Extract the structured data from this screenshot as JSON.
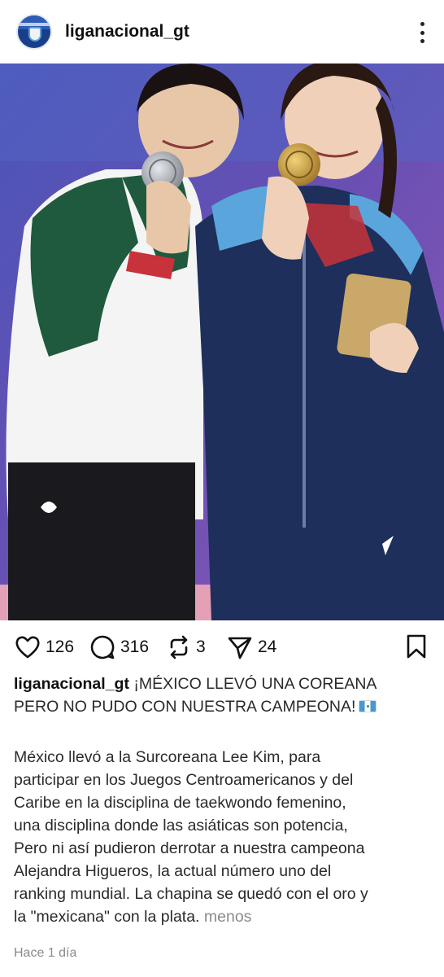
{
  "header": {
    "username": "liganacional_gt",
    "avatar_icon": "club-crest-icon",
    "more_icon": "more-vertical-icon"
  },
  "photo": {
    "description_icon": "post-photo",
    "colors": {
      "background": "#5b4fb0",
      "mexico_green": "#1f5a3e",
      "guatemala_navy": "#1d2f5a",
      "guatemala_light_blue": "#5aa6dc",
      "gold": "#c9a24a",
      "silver": "#b9bcc2"
    }
  },
  "actions": {
    "likes": "126",
    "comments": "316",
    "reposts": "3",
    "shares": "24",
    "icons": [
      "heart-icon",
      "comment-icon",
      "repost-icon",
      "share-icon",
      "bookmark-icon"
    ]
  },
  "caption": {
    "username": "liganacional_gt",
    "headline_line1": " ¡MÉXICO LLEVÓ UNA COREANA",
    "headline_line2": "PERO NO PUDO CON NUESTRA CAMPEONA!",
    "body_lines": [
      "México llevó a la Surcoreana Lee Kim, para",
      "participar en los Juegos Centroamericanos y del",
      "Caribe en la disciplina de taekwondo femenino,",
      "una disciplina donde las asiáticas son potencia,",
      "Pero ni así pudieron derrotar a nuestra campeona",
      "Alejandra Higueros, la actual número uno del",
      "ranking mundial. La chapina se quedó con el oro y",
      "la \"mexicana\" con la plata."
    ],
    "less_label": "menos"
  },
  "timestamp": "Hace 1 día"
}
